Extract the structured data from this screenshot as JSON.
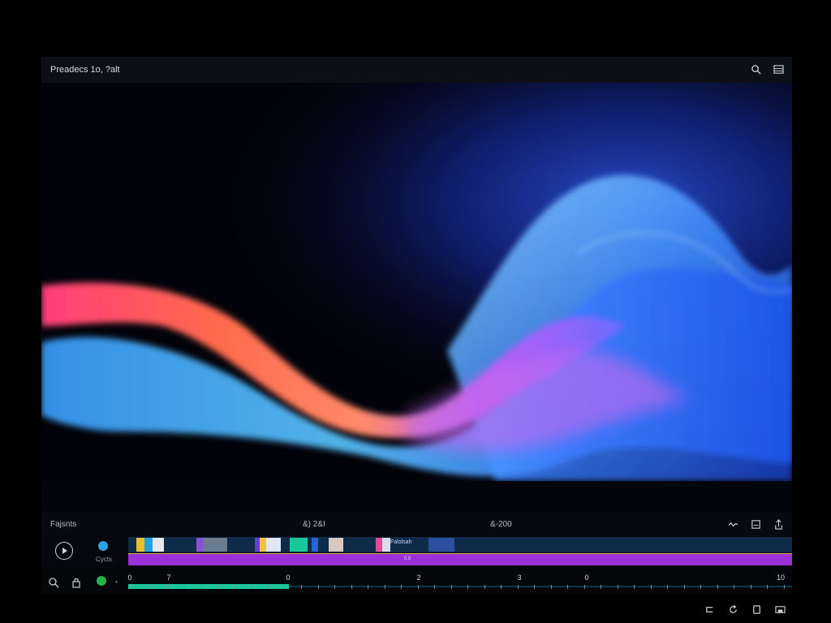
{
  "window": {
    "title": "Preadecs 1o, ?alt"
  },
  "titlebar_icons": [
    "search-icon",
    "menu-icon"
  ],
  "timeline": {
    "label": "Fajsnts",
    "time_left": "&) 2&I",
    "time_right": "&-200",
    "header_icons": [
      "waveform-icon",
      "subtitle-icon",
      "share-icon"
    ]
  },
  "tracks": {
    "cycle_label": "Cycts",
    "clip_text": "Falolsah",
    "audio_label": "0.0"
  },
  "ruler": {
    "labels": [
      "0",
      "7",
      "0",
      "2",
      "3",
      "0",
      "10"
    ],
    "progress_fraction": 0.242
  },
  "colors": {
    "accent_green": "#19c79a",
    "audio_track": "#9b2fd8",
    "video_track": "#0f2b4a"
  },
  "bottom_icons": [
    "return-icon",
    "refresh-icon",
    "square-icon",
    "tray-icon"
  ]
}
